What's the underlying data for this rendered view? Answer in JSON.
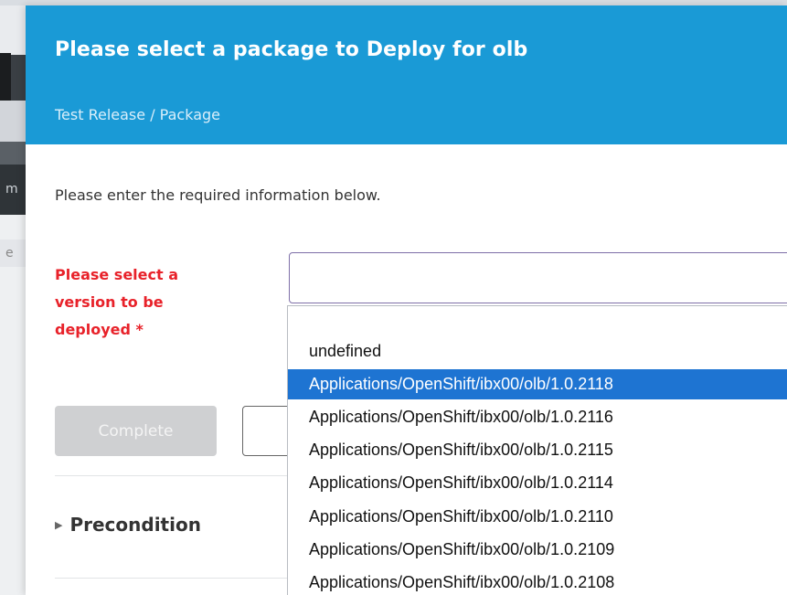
{
  "background": {
    "fragment_1": "m",
    "fragment_2": "e"
  },
  "modal": {
    "title": "Please select a package to Deploy for olb",
    "subtitle": "Test Release / Package",
    "intro": "Please enter the required information below.",
    "field_label": "Please select a version to be deployed *",
    "version_input_value": "",
    "complete_button": "Complete",
    "section": {
      "label": "Precondition",
      "icon": "chevron-right-icon"
    }
  },
  "dropdown": {
    "selected_index": 1,
    "options": [
      "undefined",
      "Applications/OpenShift/ibx00/olb/1.0.2118",
      "Applications/OpenShift/ibx00/olb/1.0.2116",
      "Applications/OpenShift/ibx00/olb/1.0.2115",
      "Applications/OpenShift/ibx00/olb/1.0.2114",
      "Applications/OpenShift/ibx00/olb/1.0.2110",
      "Applications/OpenShift/ibx00/olb/1.0.2109",
      "Applications/OpenShift/ibx00/olb/1.0.2108"
    ]
  },
  "colors": {
    "header": "#1a9ad6",
    "required_label": "#e8222a",
    "selected_option": "#1e74d2",
    "disabled_button": "#cfd0d2"
  }
}
